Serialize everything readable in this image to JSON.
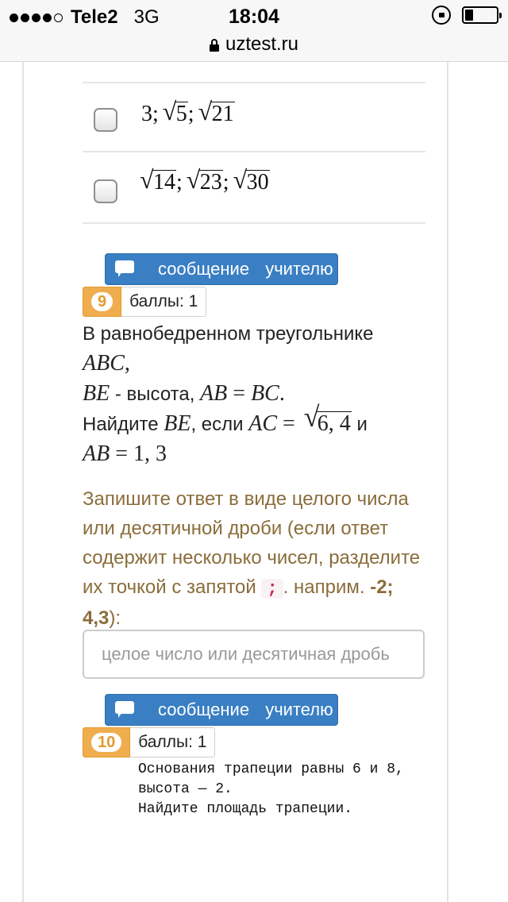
{
  "status_bar": {
    "carrier": "Tele2",
    "network": "3G",
    "time": "18:04"
  },
  "url_bar": {
    "url": "uztest.ru"
  },
  "options": [
    {
      "parts": [
        {
          "type": "num",
          "text": "3;"
        },
        {
          "type": "sqrt",
          "text": "5"
        },
        {
          "type": "num",
          "text": ";"
        },
        {
          "type": "sqrt",
          "text": "21"
        }
      ]
    },
    {
      "parts": [
        {
          "type": "sqrt",
          "text": "14"
        },
        {
          "type": "num",
          "text": ";"
        },
        {
          "type": "sqrt",
          "text": "23"
        },
        {
          "type": "num",
          "text": ";"
        },
        {
          "type": "sqrt",
          "text": "30"
        }
      ]
    }
  ],
  "message_button_label": "сообщение учителю",
  "question9": {
    "number": "9",
    "points": "баллы: 1",
    "line1": "В равнобедренном треугольнике",
    "abc": "ABC",
    "comma": ",",
    "be": "BE",
    "height_text": " - высота, ",
    "ab": "AB",
    "eq": " = ",
    "bc": "BC",
    "dot": ".",
    "find": "Найдите ",
    "be2": "BE",
    "if_text": ", если ",
    "ac": "AC",
    "eq2": " = ",
    "sqrt_val": "6, 4",
    "and": " и",
    "ab2": "AB",
    "eq3": " = ",
    "ab_val": "1, 3",
    "instruction_main": "Запишите ответ в виде целого числа или десятичной дроби (если ответ содержит несколько чисел, разделите их точкой с запятой ",
    "semicolon": ";",
    "instruction_example": ". наприм. ",
    "example": "-2; 4,3",
    "instruction_end": "):",
    "answer_placeholder": "целое число или десятичная дробь"
  },
  "question10": {
    "number": "10",
    "points": "баллы: 1",
    "text": "Основания трапеции равны 6 и 8,\nвысота — 2.\nНайдите площадь трапеции."
  }
}
